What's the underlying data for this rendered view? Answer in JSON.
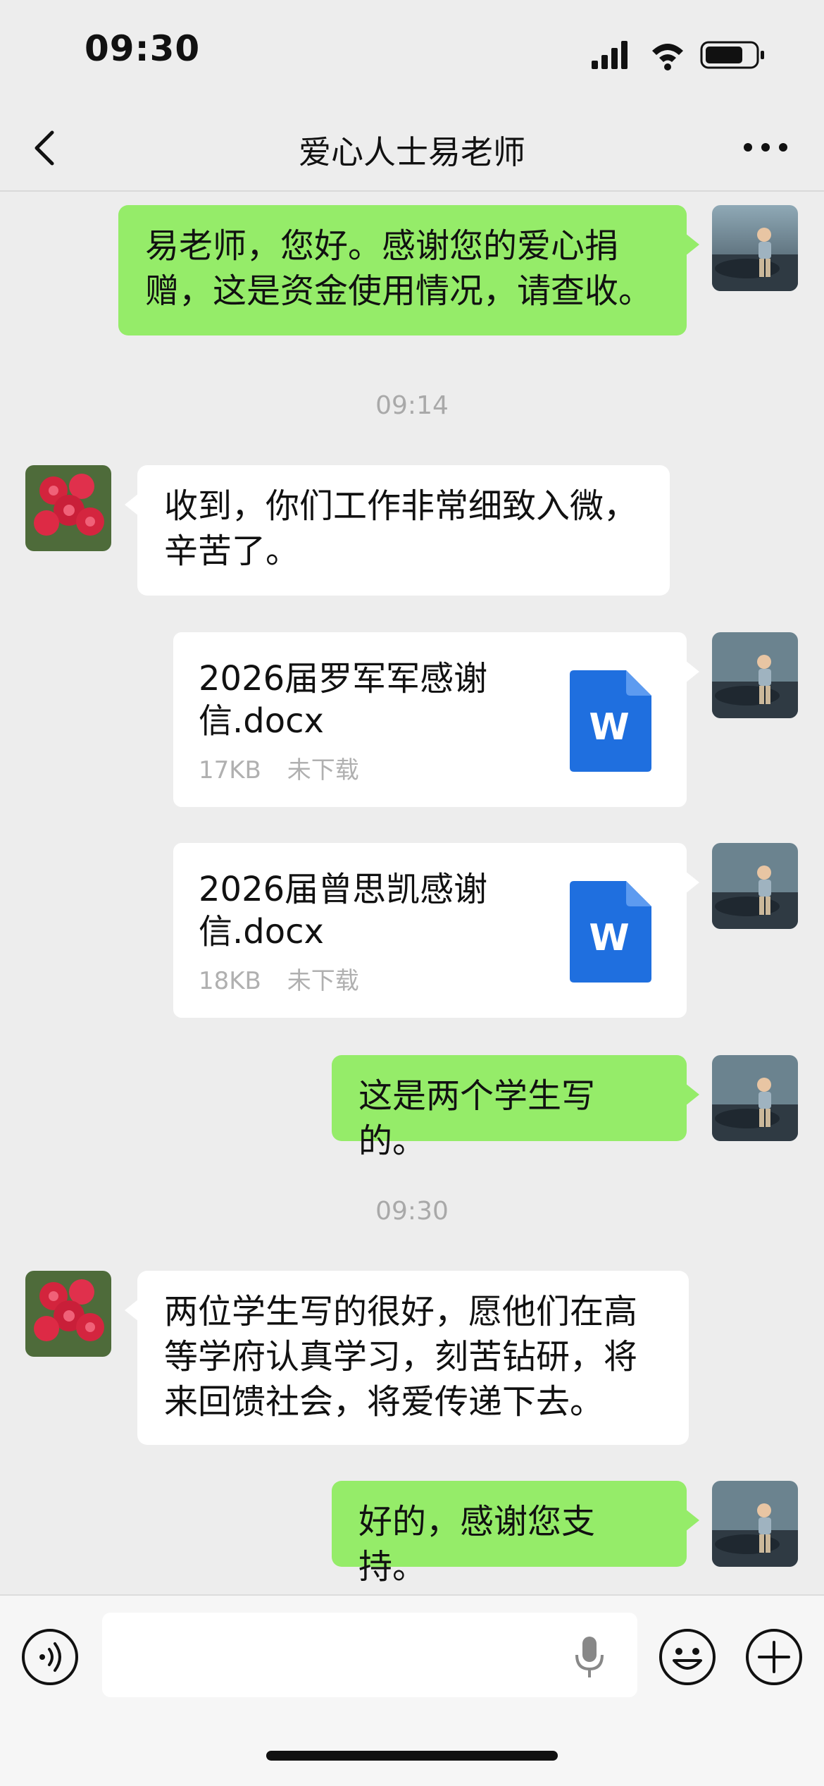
{
  "status_bar": {
    "time": "09:30"
  },
  "header": {
    "title": "爱心人士易老师"
  },
  "messages": {
    "m1": "易老师，您好。感谢您的爱心捐赠，这是资金使用情况，请查收。",
    "t1": "09:14",
    "m2": "收到，你们工作非常细致入微，辛苦了。",
    "file1": {
      "name": "2026届罗军军感谢信.docx",
      "size": "17KB",
      "status": "未下载",
      "icon_letter": "W"
    },
    "file2": {
      "name": "2026届曾思凯感谢信.docx",
      "size": "18KB",
      "status": "未下载",
      "icon_letter": "W"
    },
    "m3": "这是两个学生写的。",
    "t2": "09:30",
    "m4": "两位学生写的很好，愿他们在高等学府认真学习，刻苦钻研，将来回馈社会，将爱传递下去。",
    "m5": "好的，感谢您支持。"
  },
  "input_bar": {
    "placeholder": ""
  },
  "colors": {
    "self_bubble": "#95ec69",
    "other_bubble": "#ffffff",
    "background": "#ededed",
    "word_blue": "#1f6fdf"
  },
  "icons": [
    "signal-icon",
    "wifi-icon",
    "battery-icon",
    "back-icon",
    "more-icon",
    "voice-icon",
    "mic-icon",
    "emoji-icon",
    "plus-icon",
    "word-file-icon"
  ]
}
